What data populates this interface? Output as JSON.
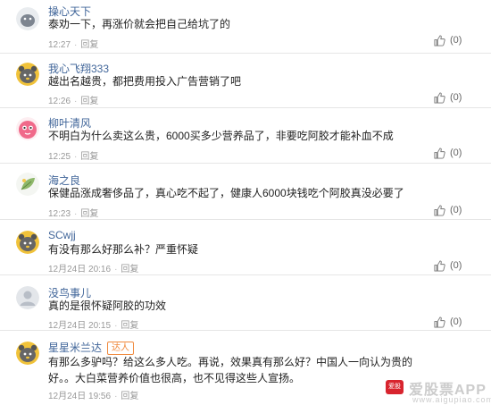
{
  "comments": [
    {
      "username": "操心天下",
      "text": "泰劝一下，再涨价就会把自己给坑了的",
      "time": "12:27",
      "reply_label": "回复",
      "likes": "(0)",
      "avatar": "grey-blob-avatar-icon"
    },
    {
      "username": "我心飞翔333",
      "text": "越出名越贵，都把费用投入广告营销了吧",
      "time": "12:26",
      "reply_label": "回复",
      "likes": "(0)",
      "avatar": "gray-bear-avatar-icon"
    },
    {
      "username": "柳叶清风",
      "text": "不明白为什么卖这么贵，6000买多少营养品了，非要吃阿胶才能补血不成",
      "time": "12:25",
      "reply_label": "回复",
      "likes": "(0)",
      "avatar": "pink-character-avatar-icon"
    },
    {
      "username": "海之良",
      "text": "保健品涨成奢侈品了，真心吃不起了，健康人6000块钱吃个阿胶真没必要了",
      "time": "12:23",
      "reply_label": "回复",
      "likes": "(0)",
      "avatar": "leaf-avatar-icon"
    },
    {
      "username": "SCwjj",
      "text": "有没有那么好那么补？严重怀疑",
      "time": "12月24日 20:16",
      "reply_label": "回复",
      "likes": "(0)",
      "avatar": "gray-bear-avatar-icon"
    },
    {
      "username": "没鸟事儿",
      "text": "真的是很怀疑阿胶的功效",
      "time": "12月24日 20:15",
      "reply_label": "回复",
      "likes": "(0)",
      "avatar": "default-avatar-icon"
    },
    {
      "username": "星星米兰达",
      "badge": "达人",
      "text": "有那么多驴吗？给这么多人吃。再说，效果真有那么好？中国人一向认为贵的好。。大白菜营养价值也很高，也不见得这些人宣扬。",
      "time": "12月24日 19:56",
      "reply_label": "回复",
      "likes": "(0)",
      "avatar": "gray-bear-avatar-icon"
    }
  ],
  "watermark": {
    "logo_text": "爱股票",
    "name": "爱股票APP",
    "url": "www.aigupiao.com"
  },
  "colors": {
    "username": "#406599",
    "meta": "#999999",
    "divider": "#e6e6e6",
    "badge": "#f08a3e"
  }
}
